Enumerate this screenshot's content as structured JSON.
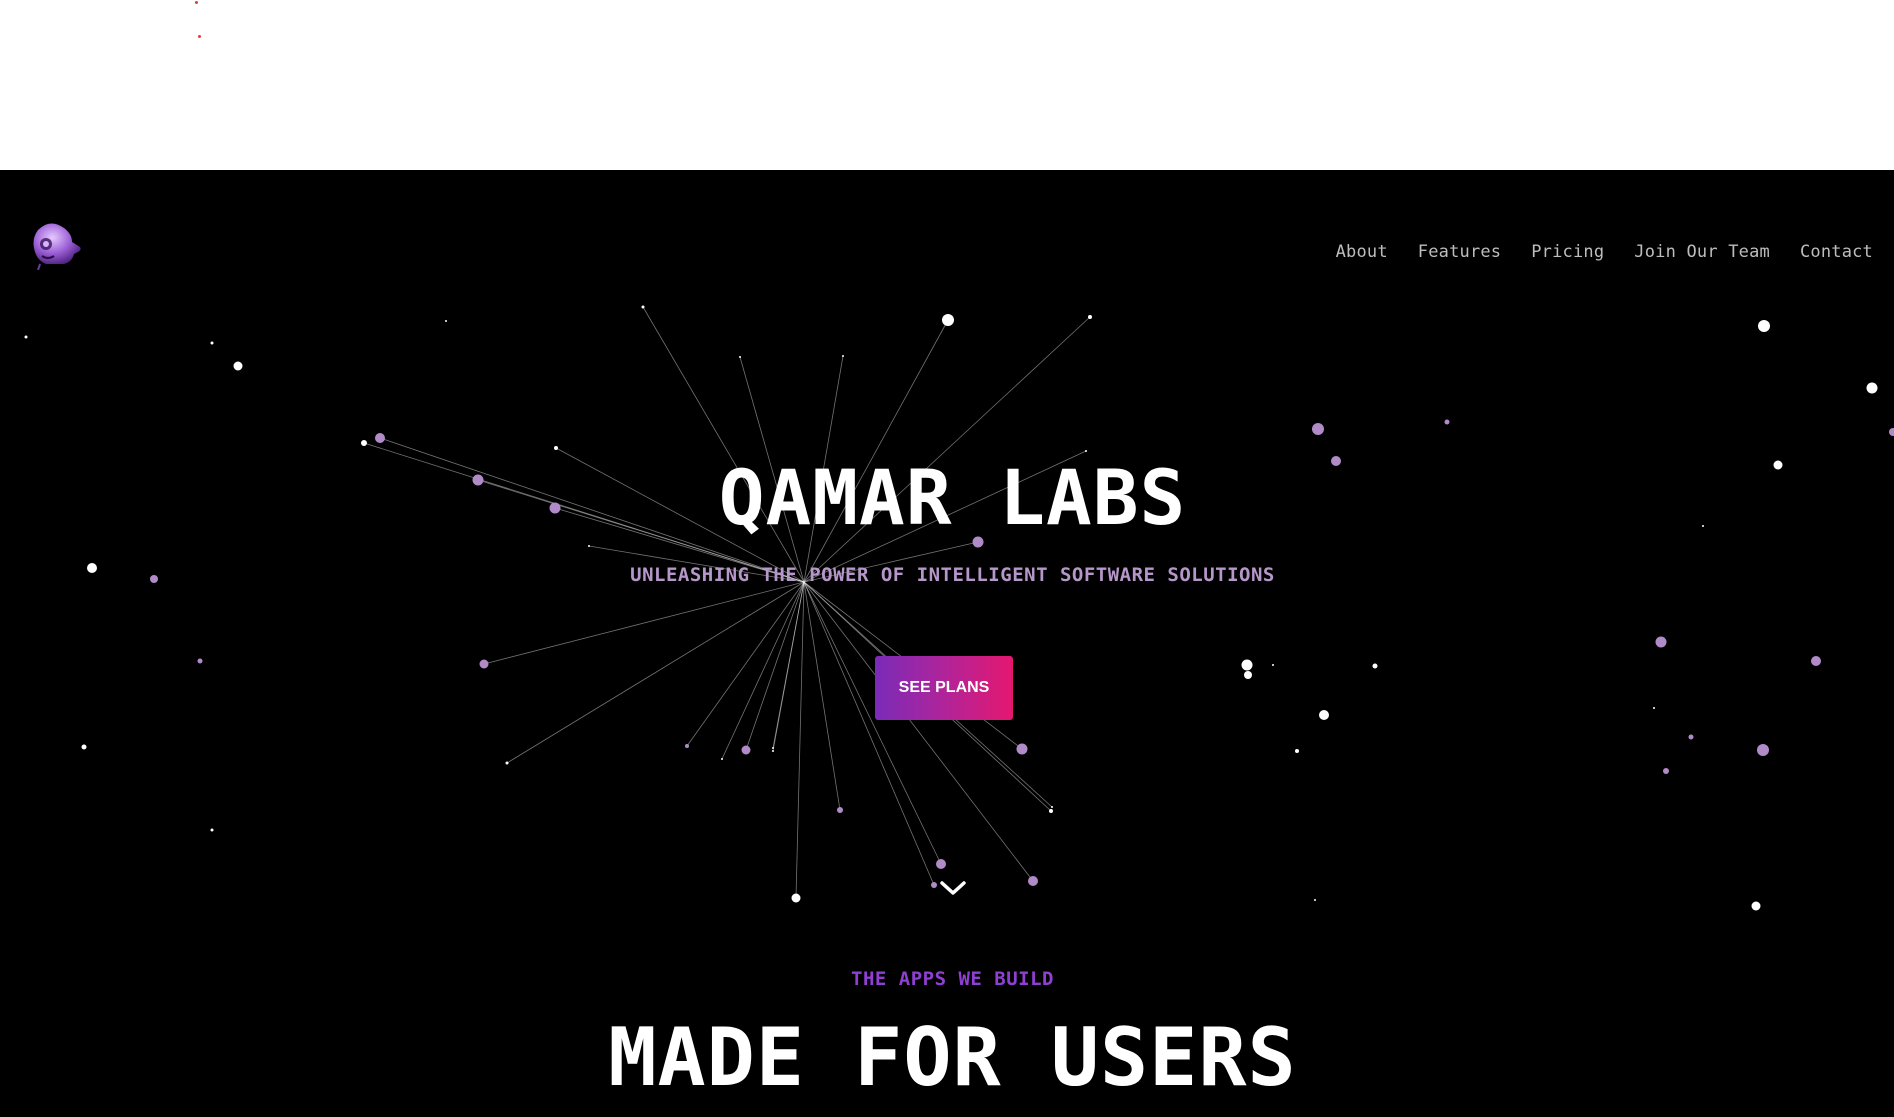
{
  "nav": {
    "logo_icon": "robot-head-icon",
    "items": [
      {
        "label": "About"
      },
      {
        "label": "Features"
      },
      {
        "label": "Pricing"
      },
      {
        "label": "Join Our Team"
      },
      {
        "label": "Contact"
      }
    ]
  },
  "hero": {
    "title": "QAMAR LABS",
    "subtitle": "UNLEASHING THE POWER OF INTELLIGENT SOFTWARE SOLUTIONS",
    "cta_label": "SEE PLANS",
    "scroll_icon": "chevron-down-icon"
  },
  "section": {
    "eyebrow": "THE APPS WE BUILD",
    "title": "MADE FOR USERS"
  },
  "colors": {
    "background": "#000000",
    "accent_purple": "#8f3fd1",
    "subtitle_lavender": "#b597c9",
    "particle_purple": "#b08bc8",
    "cta_gradient_start": "#7a2bb8",
    "cta_gradient_end": "#e5176f"
  }
}
